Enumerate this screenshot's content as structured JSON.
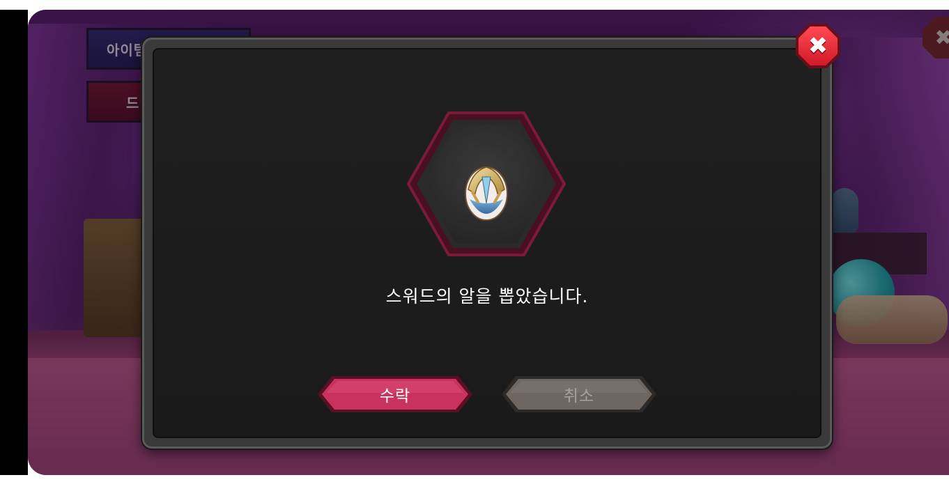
{
  "background": {
    "item_code_button": "아이템코",
    "drill_button": "드빌ㄱ"
  },
  "dialog": {
    "message": "스워드의 알을 뽑았습니다.",
    "accept_label": "수락",
    "cancel_label": "취소",
    "item_icon": "sword-egg-icon",
    "close_icon": "close-icon"
  },
  "colors": {
    "accept": "#c8325c",
    "cancel": "#6e6660",
    "close": "#e0202e",
    "hex_border": "#6a1830",
    "dialog_bg": "#1c1c1c"
  }
}
